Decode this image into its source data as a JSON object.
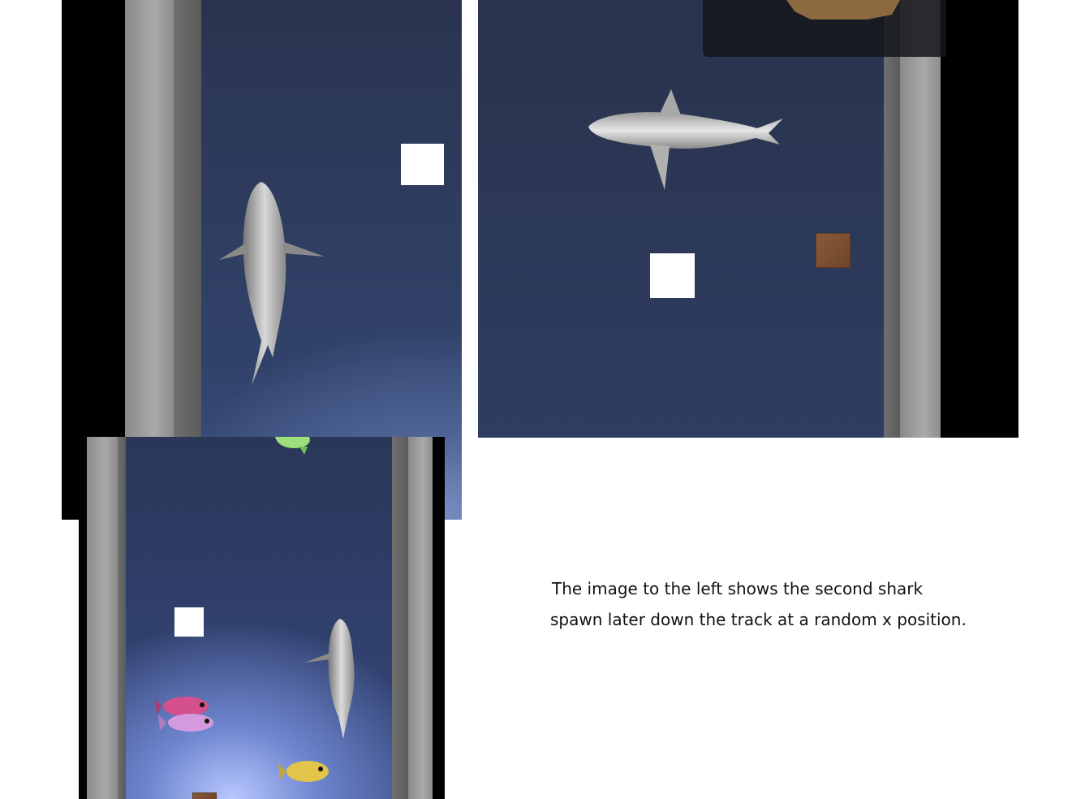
{
  "caption": {
    "line1": "The image to the left shows the second shark",
    "line2": "spawn later down the track at a random x position."
  },
  "colors": {
    "water_top": "#2b3650",
    "water_glow": "#9fb4f0",
    "wall": "#9a9a9a",
    "block": "#ffffff",
    "crate": "#7a4e30"
  },
  "icons": [
    "shark",
    "fish-green",
    "fish-pink",
    "fish-yellow",
    "white-block",
    "crate",
    "rock"
  ]
}
